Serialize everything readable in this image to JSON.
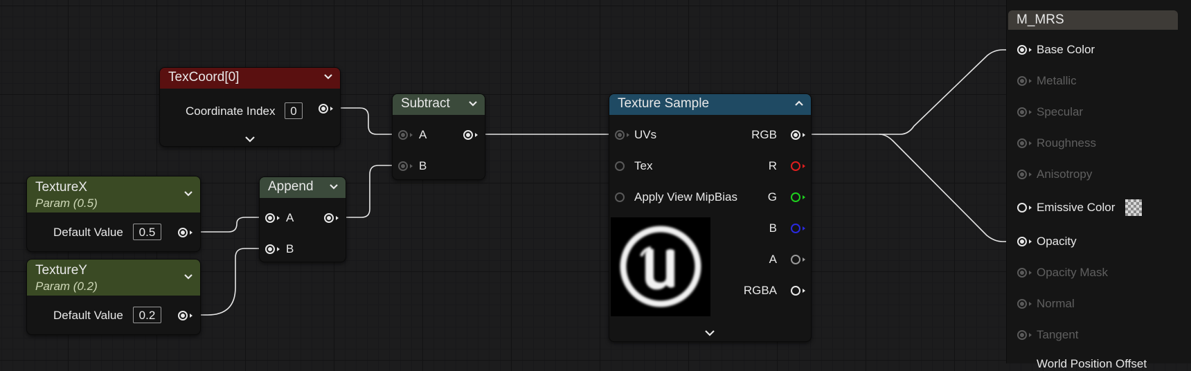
{
  "nodes": {
    "texcoord": {
      "title": "TexCoord[0]",
      "param_label": "Coordinate Index",
      "param_value": "0",
      "header_color": "#5a1010"
    },
    "texture_x": {
      "title": "TextureX",
      "subtitle": "Param (0.5)",
      "param_label": "Default Value",
      "param_value": "0.5",
      "header_color": "#3a4a24"
    },
    "texture_y": {
      "title": "TextureY",
      "subtitle": "Param (0.2)",
      "param_label": "Default Value",
      "param_value": "0.2",
      "header_color": "#3a4a24"
    },
    "append": {
      "title": "Append",
      "inputs": [
        "A",
        "B"
      ],
      "header_color": "#3b4a3b"
    },
    "subtract": {
      "title": "Subtract",
      "inputs": [
        "A",
        "B"
      ],
      "header_color": "#3b4a3b"
    },
    "texture_sample": {
      "title": "Texture Sample",
      "inputs": [
        "UVs",
        "Tex",
        "Apply View MipBias"
      ],
      "outputs": [
        "RGB",
        "R",
        "G",
        "B",
        "A",
        "RGBA"
      ],
      "header_color": "#1f4a63",
      "output_colors": {
        "R": "#e01e1e",
        "G": "#1ed01e",
        "B": "#2a2ae0",
        "A": "#9a9a9a"
      }
    },
    "material": {
      "title": "M_MRS",
      "inputs": [
        {
          "label": "Base Color",
          "active": true
        },
        {
          "label": "Metallic",
          "active": false
        },
        {
          "label": "Specular",
          "active": false
        },
        {
          "label": "Roughness",
          "active": false
        },
        {
          "label": "Anisotropy",
          "active": false
        },
        {
          "label": "Emissive Color",
          "active": true
        },
        {
          "label": "Opacity",
          "active": true
        },
        {
          "label": "Opacity Mask",
          "active": false
        },
        {
          "label": "Normal",
          "active": false
        },
        {
          "label": "Tangent",
          "active": false
        },
        {
          "label": "World Position Offset",
          "active": false
        }
      ]
    }
  },
  "icons": {
    "collapse": "chevron-down-icon",
    "expand": "chevron-up-icon",
    "thumbnail": "unreal-logo-icon",
    "emissive_preview": "checker-icon"
  }
}
